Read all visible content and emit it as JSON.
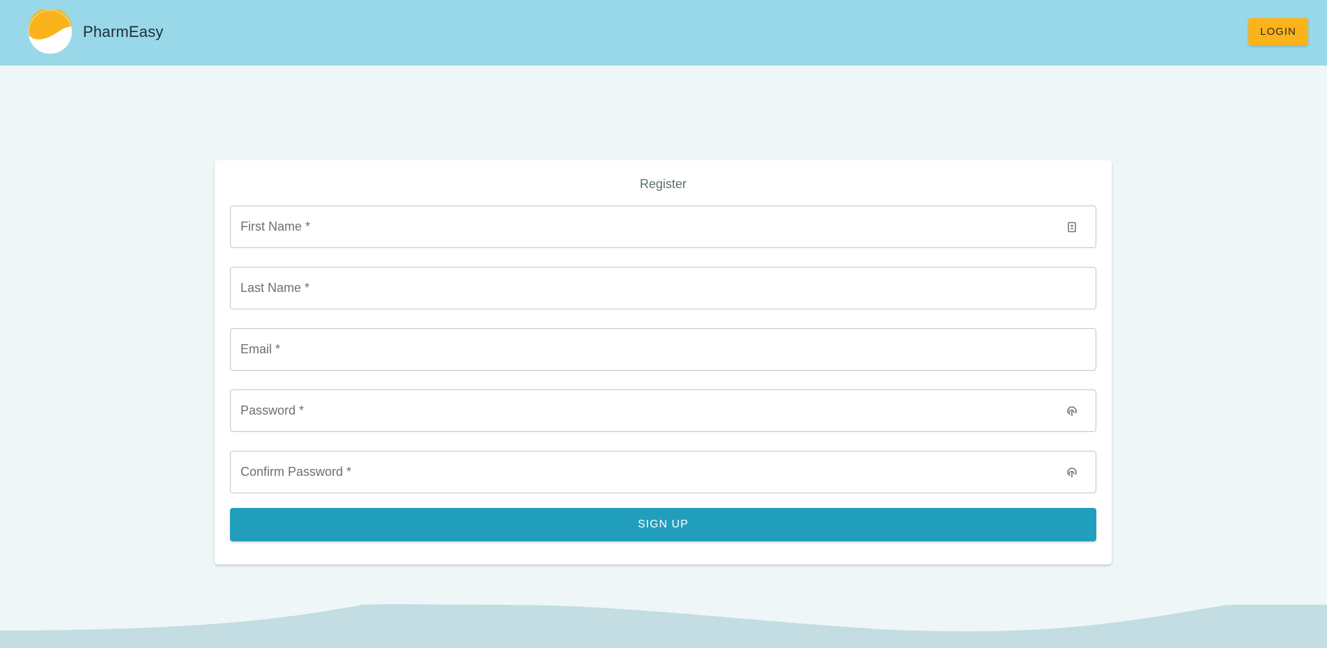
{
  "app": {
    "brand_name": "PharmEasy",
    "login_label": "LOGIN"
  },
  "form": {
    "title": "Register",
    "fields": [
      {
        "placeholder": "First Name *",
        "value": "",
        "icon": "contact-card-icon"
      },
      {
        "placeholder": "Last Name *",
        "value": ""
      },
      {
        "placeholder": "Email *",
        "value": ""
      },
      {
        "placeholder": "Password *",
        "value": "",
        "icon": "fingerprint-icon"
      },
      {
        "placeholder": "Confirm Password *",
        "value": "",
        "icon": "fingerprint-icon"
      }
    ],
    "submit_label": "SIGN UP"
  },
  "colors": {
    "header_bg": "#98d8e8",
    "page_bg": "#eef6f7",
    "login_button": "#fbb31b",
    "signup_button": "#229ebd",
    "wave": "#c3dde2"
  }
}
